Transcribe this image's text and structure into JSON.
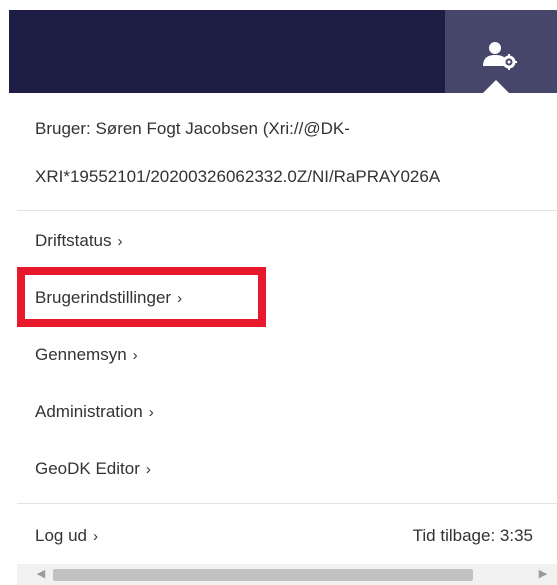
{
  "header": {
    "user_button_icon": "user-settings-icon",
    "background_color": "#1d1d45",
    "button_color": "#45466a"
  },
  "menu": {
    "user_line1": "Bruger: Søren Fogt Jacobsen (Xri://@DK-",
    "user_line2": "XRI*19552101/20200326062332.0Z/NI/RaPRAY026A",
    "items": [
      {
        "label": "Driftstatus",
        "chevron": "›"
      },
      {
        "label": "Brugerindstillinger",
        "chevron": "›"
      },
      {
        "label": "Gennemsyn",
        "chevron": "›"
      },
      {
        "label": "Administration",
        "chevron": "›"
      },
      {
        "label": "GeoDK Editor",
        "chevron": "›"
      }
    ],
    "logout_label": "Log ud",
    "logout_chevron": "›",
    "timer_text": "Tid tilbage: 3:35",
    "highlight_color": "#e8192c"
  },
  "scrollbar": {
    "left_arrow": "◀",
    "right_arrow": "▶"
  }
}
